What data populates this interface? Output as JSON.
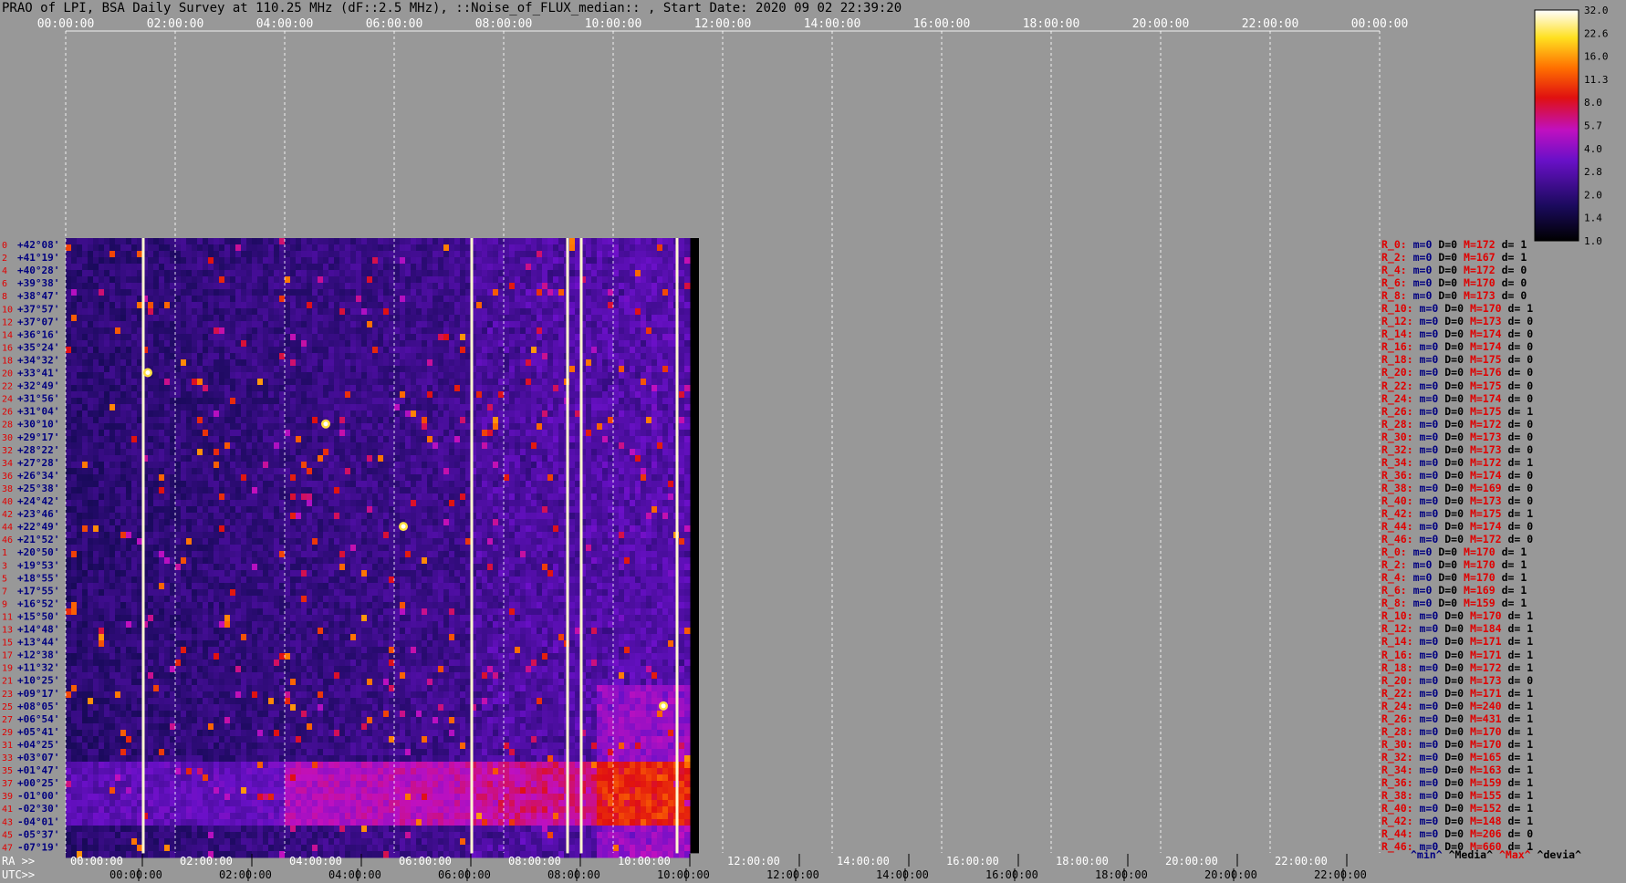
{
  "title": "PRAO of LPI, BSA Daily Survey at 110.25 MHz (dF::2.5 MHz), ::Noise_of_FLUX_median:: , Start Date: 2020 09 02 22:39:20",
  "chart_data": {
    "type": "heatmap",
    "x_top_ticks": [
      "00:00:00",
      "02:00:00",
      "04:00:00",
      "06:00:00",
      "08:00:00",
      "10:00:00",
      "12:00:00",
      "14:00:00",
      "16:00:00",
      "18:00:00",
      "20:00:00",
      "22:00:00",
      "00:00:00"
    ],
    "ra_axis_label": "RA >>",
    "ra_ticks": [
      "00:00:00",
      "02:00:00",
      "04:00:00",
      "06:00:00",
      "08:00:00",
      "10:00:00",
      "12:00:00",
      "14:00:00",
      "16:00:00",
      "18:00:00",
      "20:00:00",
      "22:00:00"
    ],
    "utc_axis_label": "UTC>>",
    "utc_ticks": [
      "00:00:00",
      "02:00:00",
      "04:00:00",
      "06:00:00",
      "08:00:00",
      "10:00:00",
      "12:00:00",
      "14:00:00",
      "16:00:00",
      "18:00:00",
      "20:00:00",
      "22:00:00",
      "00:00:00"
    ],
    "declinations": [
      "+42°08'",
      "+41°19'",
      "+40°28'",
      "+39°38'",
      "+38°47'",
      "+37°57'",
      "+37°07'",
      "+36°16'",
      "+35°24'",
      "+34°32'",
      "+33°41'",
      "+32°49'",
      "+31°56'",
      "+31°04'",
      "+30°10'",
      "+29°17'",
      "+28°22'",
      "+27°28'",
      "+26°34'",
      "+25°38'",
      "+24°42'",
      "+23°46'",
      "+22°49'",
      "+21°52'",
      "+20°50'",
      "+19°53'",
      "+18°55'",
      "+17°55'",
      "+16°52'",
      "+15°50'",
      "+14°48'",
      "+13°44'",
      "+12°38'",
      "+11°32'",
      "+10°25'",
      "+09°17'",
      "+08°05'",
      "+06°54'",
      "+05°41'",
      "+04°25'",
      "+03°07'",
      "+01°47'",
      "+00°25'",
      "-01°00'",
      "-02°30'",
      "-04°01'",
      "-05°37'",
      "-07°19'"
    ],
    "row_numbers": [
      "0",
      "2",
      "4",
      "6",
      "8",
      "10",
      "12",
      "14",
      "16",
      "18",
      "20",
      "22",
      "24",
      "26",
      "28",
      "30",
      "32",
      "34",
      "36",
      "38",
      "40",
      "42",
      "44",
      "46",
      "1",
      "3",
      "5",
      "7",
      "9",
      "11",
      "13",
      "15",
      "17",
      "19",
      "21",
      "23",
      "25",
      "27",
      "29",
      "31",
      "33",
      "35",
      "37",
      "39",
      "41",
      "43",
      "45",
      "47"
    ],
    "colorbar": {
      "ticks": [
        "32.0",
        "22.6",
        "16.0",
        "11.3",
        "8.0",
        "5.7",
        "4.0",
        "2.8",
        "2.0",
        "1.4",
        "1.0"
      ],
      "scale": "log",
      "colormap": "black-blue-purple-red-orange-yellow-white"
    },
    "data_extent_x": [
      "00:00:00",
      "11:20:00"
    ],
    "bright_sources": [
      {
        "time": "06:10:00",
        "dec": "+22°49'"
      },
      {
        "time": "04:45:00",
        "dec": "+30°10'"
      },
      {
        "time": "01:30:00",
        "dec": "+33°41'"
      },
      {
        "time": "10:55:00",
        "dec": "+08°05'"
      }
    ],
    "vertical_stripes": [
      "01:25:00",
      "07:25:00",
      "09:10:00",
      "09:25:00",
      "11:10:00"
    ]
  },
  "row_stats": {
    "labels": [
      "R_0:",
      "R_2:",
      "R_4:",
      "R_6:",
      "R_8:",
      "R_10:",
      "R_12:",
      "R_14:",
      "R_16:",
      "R_18:",
      "R_20:",
      "R_22:",
      "R_24:",
      "R_26:",
      "R_28:",
      "R_30:",
      "R_32:",
      "R_34:",
      "R_36:",
      "R_38:",
      "R_40:",
      "R_42:",
      "R_44:",
      "R_46:",
      "R_0:",
      "R_2:",
      "R_4:",
      "R_6:",
      "R_8:",
      "R_10:",
      "R_12:",
      "R_14:",
      "R_16:",
      "R_18:",
      "R_20:",
      "R_22:",
      "R_24:",
      "R_26:",
      "R_28:",
      "R_30:",
      "R_32:",
      "R_34:",
      "R_36:",
      "R_38:",
      "R_40:",
      "R_42:",
      "R_44:",
      "R_46:"
    ],
    "m": [
      "m=0",
      "m=0",
      "m=0",
      "m=0",
      "m=0",
      "m=0",
      "m=0",
      "m=0",
      "m=0",
      "m=0",
      "m=0",
      "m=0",
      "m=0",
      "m=0",
      "m=0",
      "m=0",
      "m=0",
      "m=0",
      "m=0",
      "m=0",
      "m=0",
      "m=0",
      "m=0",
      "m=0",
      "m=0",
      "m=0",
      "m=0",
      "m=0",
      "m=0",
      "m=0",
      "m=0",
      "m=0",
      "m=0",
      "m=0",
      "m=0",
      "m=0",
      "m=0",
      "m=0",
      "m=0",
      "m=0",
      "m=0",
      "m=0",
      "m=0",
      "m=0",
      "m=0",
      "m=0",
      "m=0",
      "m=0"
    ],
    "D": [
      "D=0",
      "D=0",
      "D=0",
      "D=0",
      "D=0",
      "D=0",
      "D=0",
      "D=0",
      "D=0",
      "D=0",
      "D=0",
      "D=0",
      "D=0",
      "D=0",
      "D=0",
      "D=0",
      "D=0",
      "D=0",
      "D=0",
      "D=0",
      "D=0",
      "D=0",
      "D=0",
      "D=0",
      "D=0",
      "D=0",
      "D=0",
      "D=0",
      "D=0",
      "D=0",
      "D=0",
      "D=0",
      "D=0",
      "D=0",
      "D=0",
      "D=0",
      "D=0",
      "D=0",
      "D=0",
      "D=0",
      "D=0",
      "D=0",
      "D=0",
      "D=0",
      "D=0",
      "D=0",
      "D=0",
      "D=0"
    ],
    "M": [
      "M=172",
      "M=167",
      "M=172",
      "M=170",
      "M=173",
      "M=170",
      "M=173",
      "M=174",
      "M=174",
      "M=175",
      "M=176",
      "M=175",
      "M=174",
      "M=175",
      "M=172",
      "M=173",
      "M=173",
      "M=172",
      "M=174",
      "M=169",
      "M=173",
      "M=175",
      "M=174",
      "M=172",
      "M=170",
      "M=170",
      "M=170",
      "M=169",
      "M=159",
      "M=170",
      "M=184",
      "M=171",
      "M=171",
      "M=172",
      "M=173",
      "M=171",
      "M=240",
      "M=431",
      "M=170",
      "M=170",
      "M=165",
      "M=163",
      "M=159",
      "M=155",
      "M=152",
      "M=148",
      "M=206",
      "M=660"
    ],
    "d": [
      "d= 1",
      "d= 1",
      "d= 0",
      "d= 0",
      "d= 0",
      "d= 1",
      "d= 0",
      "d= 0",
      "d= 0",
      "d= 0",
      "d= 0",
      "d= 0",
      "d= 0",
      "d= 1",
      "d= 0",
      "d= 0",
      "d= 0",
      "d= 1",
      "d= 0",
      "d= 0",
      "d= 0",
      "d= 1",
      "d= 0",
      "d= 0",
      "d= 1",
      "d= 1",
      "d= 1",
      "d= 1",
      "d= 1",
      "d= 1",
      "d= 1",
      "d= 1",
      "d= 1",
      "d= 1",
      "d= 0",
      "d= 1",
      "d= 1",
      "d= 1",
      "d= 1",
      "d= 1",
      "d= 1",
      "d= 1",
      "d= 1",
      "d= 1",
      "d= 1",
      "d= 1",
      "d= 0",
      "d= 1"
    ]
  },
  "stats_legend": {
    "min": "^min^",
    "median": "^Media^",
    "max": "^Max^",
    "deviation": "^devia^"
  },
  "colors": {
    "background": "#989898",
    "red_label": "#e00000",
    "blue_label": "#000080"
  }
}
